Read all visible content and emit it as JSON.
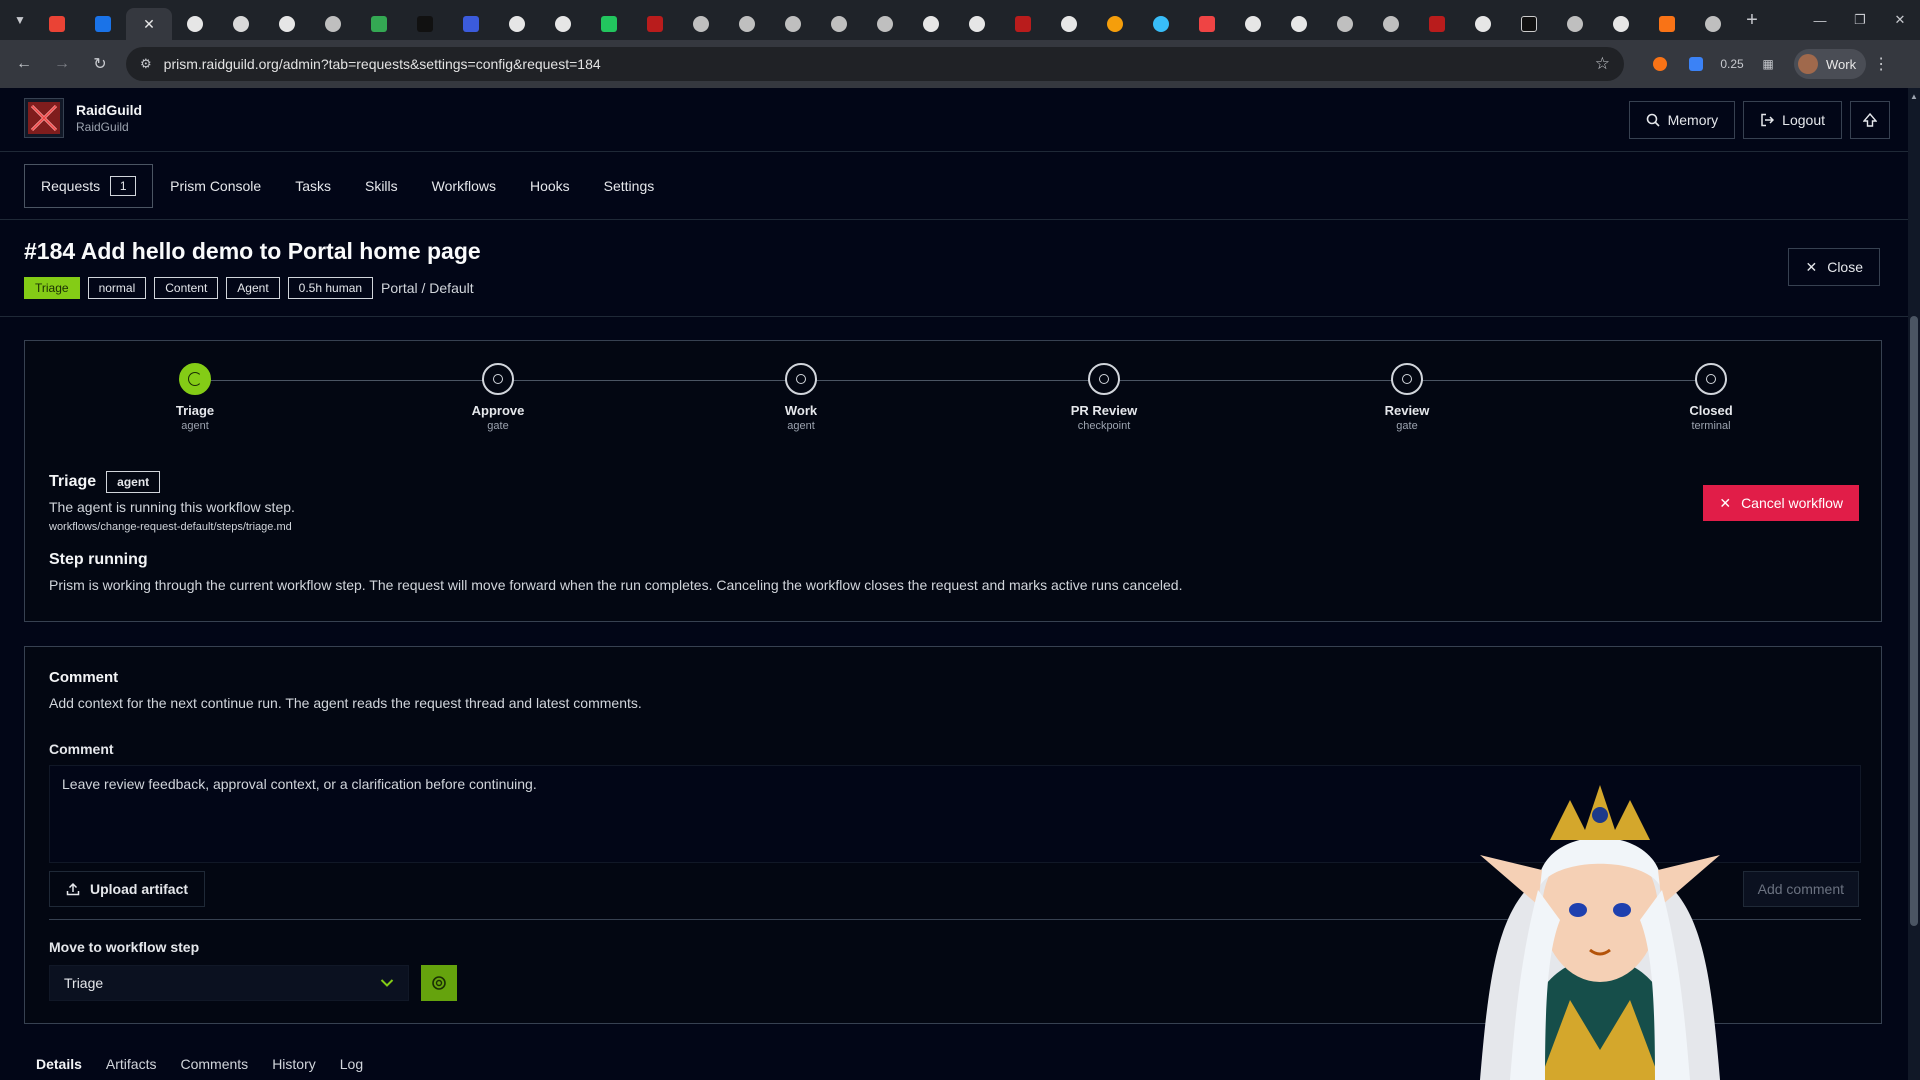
{
  "browser": {
    "url": "prism.raidguild.org/admin?tab=requests&settings=config&request=184",
    "ext_badge": "0.25",
    "profile_label": "Work"
  },
  "app": {
    "brand_name": "RaidGuild",
    "brand_sub": "RaidGuild",
    "header_buttons": {
      "memory": "Memory",
      "logout": "Logout"
    },
    "nav": {
      "requests": "Requests",
      "requests_count": "1",
      "items": [
        "Prism Console",
        "Tasks",
        "Skills",
        "Workflows",
        "Hooks",
        "Settings"
      ]
    }
  },
  "request": {
    "title": "#184 Add hello demo to Portal home page",
    "badges": {
      "status": "Triage",
      "priority": "normal",
      "type": "Content",
      "owner": "Agent",
      "estimate": "0.5h human"
    },
    "project": "Portal / Default",
    "close_label": "Close"
  },
  "workflow": {
    "steps": [
      {
        "name": "Triage",
        "kind": "agent",
        "active": true
      },
      {
        "name": "Approve",
        "kind": "gate",
        "active": false
      },
      {
        "name": "Work",
        "kind": "agent",
        "active": false
      },
      {
        "name": "PR Review",
        "kind": "checkpoint",
        "active": false
      },
      {
        "name": "Review",
        "kind": "gate",
        "active": false
      },
      {
        "name": "Closed",
        "kind": "terminal",
        "active": false
      }
    ],
    "current": {
      "name": "Triage",
      "kind": "agent",
      "description": "The agent is running this workflow step.",
      "path": "workflows/change-request-default/steps/triage.md"
    },
    "running_title": "Step running",
    "running_desc": "Prism is working through the current workflow step. The request will move forward when the run completes. Canceling the workflow closes the request and marks active runs canceled.",
    "cancel_label": "Cancel workflow"
  },
  "comment": {
    "title": "Comment",
    "subtitle": "Add context for the next continue run. The agent reads the request thread and latest comments.",
    "label": "Comment",
    "placeholder": "Leave review feedback, approval context, or a clarification before continuing.",
    "upload_label": "Upload artifact",
    "add_label": "Add comment",
    "move_label": "Move to workflow step",
    "move_selected": "Triage"
  },
  "bottom_tabs": [
    "Details",
    "Artifacts",
    "Comments",
    "History",
    "Log"
  ],
  "colors": {
    "accent": "#84cc16",
    "danger": "#e11d48",
    "bg": "#020617"
  }
}
